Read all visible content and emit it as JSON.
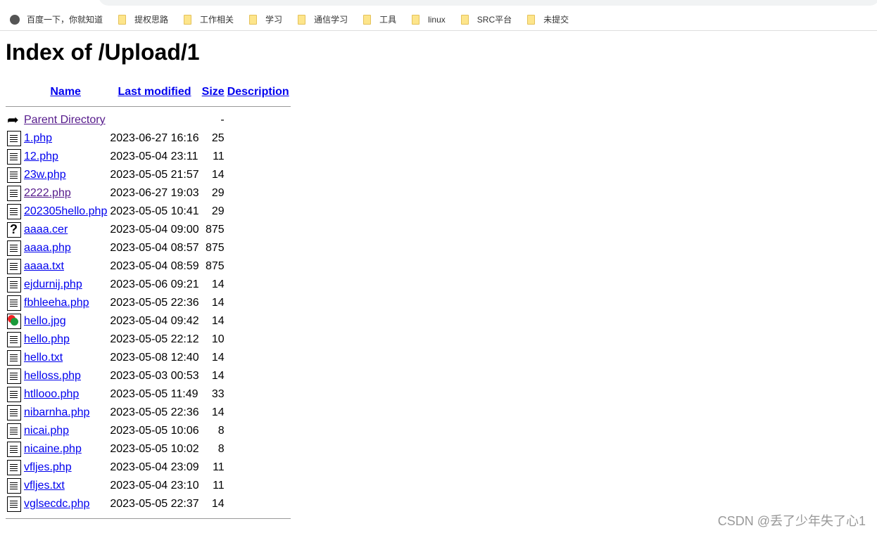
{
  "bookmarks": [
    {
      "label": "百度一下，你就知道",
      "icon": "globe-icon"
    },
    {
      "label": "提权思路",
      "icon": "folder-icon"
    },
    {
      "label": "工作相关",
      "icon": "folder-icon"
    },
    {
      "label": "学习",
      "icon": "folder-icon"
    },
    {
      "label": "通信学习",
      "icon": "folder-icon"
    },
    {
      "label": "工具",
      "icon": "folder-icon"
    },
    {
      "label": "linux",
      "icon": "folder-icon"
    },
    {
      "label": "SRC平台",
      "icon": "folder-icon"
    },
    {
      "label": "未提交",
      "icon": "folder-icon"
    }
  ],
  "title": "Index of /Upload/1",
  "columns": {
    "name": "Name",
    "modified": "Last modified",
    "size": "Size",
    "description": "Description"
  },
  "parent": {
    "label": "Parent Directory",
    "size": "-"
  },
  "files": [
    {
      "name": "1.php",
      "modified": "2023-06-27 16:16",
      "size": "25",
      "icon": "text"
    },
    {
      "name": "12.php",
      "modified": "2023-05-04 23:11",
      "size": "11",
      "icon": "text"
    },
    {
      "name": "23w.php",
      "modified": "2023-05-05 21:57",
      "size": "14",
      "icon": "text"
    },
    {
      "name": "2222.php",
      "modified": "2023-06-27 19:03",
      "size": "29",
      "icon": "text",
      "visited": true
    },
    {
      "name": "202305hello.php",
      "modified": "2023-05-05 10:41",
      "size": "29",
      "icon": "text"
    },
    {
      "name": "aaaa.cer",
      "modified": "2023-05-04 09:00",
      "size": "875",
      "icon": "unknown"
    },
    {
      "name": "aaaa.php",
      "modified": "2023-05-04 08:57",
      "size": "875",
      "icon": "text"
    },
    {
      "name": "aaaa.txt",
      "modified": "2023-05-04 08:59",
      "size": "875",
      "icon": "text"
    },
    {
      "name": "ejdurnij.php",
      "modified": "2023-05-06 09:21",
      "size": "14",
      "icon": "text"
    },
    {
      "name": "fbhleeha.php",
      "modified": "2023-05-05 22:36",
      "size": "14",
      "icon": "text"
    },
    {
      "name": "hello.jpg",
      "modified": "2023-05-04 09:42",
      "size": "14",
      "icon": "image"
    },
    {
      "name": "hello.php",
      "modified": "2023-05-05 22:12",
      "size": "10",
      "icon": "text"
    },
    {
      "name": "hello.txt",
      "modified": "2023-05-08 12:40",
      "size": "14",
      "icon": "text"
    },
    {
      "name": "helloss.php",
      "modified": "2023-05-03 00:53",
      "size": "14",
      "icon": "text"
    },
    {
      "name": "htllooo.php",
      "modified": "2023-05-05 11:49",
      "size": "33",
      "icon": "text"
    },
    {
      "name": "nibarnha.php",
      "modified": "2023-05-05 22:36",
      "size": "14",
      "icon": "text"
    },
    {
      "name": "nicai.php",
      "modified": "2023-05-05 10:06",
      "size": "8",
      "icon": "text"
    },
    {
      "name": "nicaine.php",
      "modified": "2023-05-05 10:02",
      "size": "8",
      "icon": "text"
    },
    {
      "name": "vfljes.php",
      "modified": "2023-05-04 23:09",
      "size": "11",
      "icon": "text"
    },
    {
      "name": "vfljes.txt",
      "modified": "2023-05-04 23:10",
      "size": "11",
      "icon": "text"
    },
    {
      "name": "vglsecdc.php",
      "modified": "2023-05-05 22:37",
      "size": "14",
      "icon": "text"
    }
  ],
  "watermark": "CSDN @丢了少年失了心1",
  "colors": {
    "link": "#0000ee",
    "visited": "#551a8b"
  }
}
